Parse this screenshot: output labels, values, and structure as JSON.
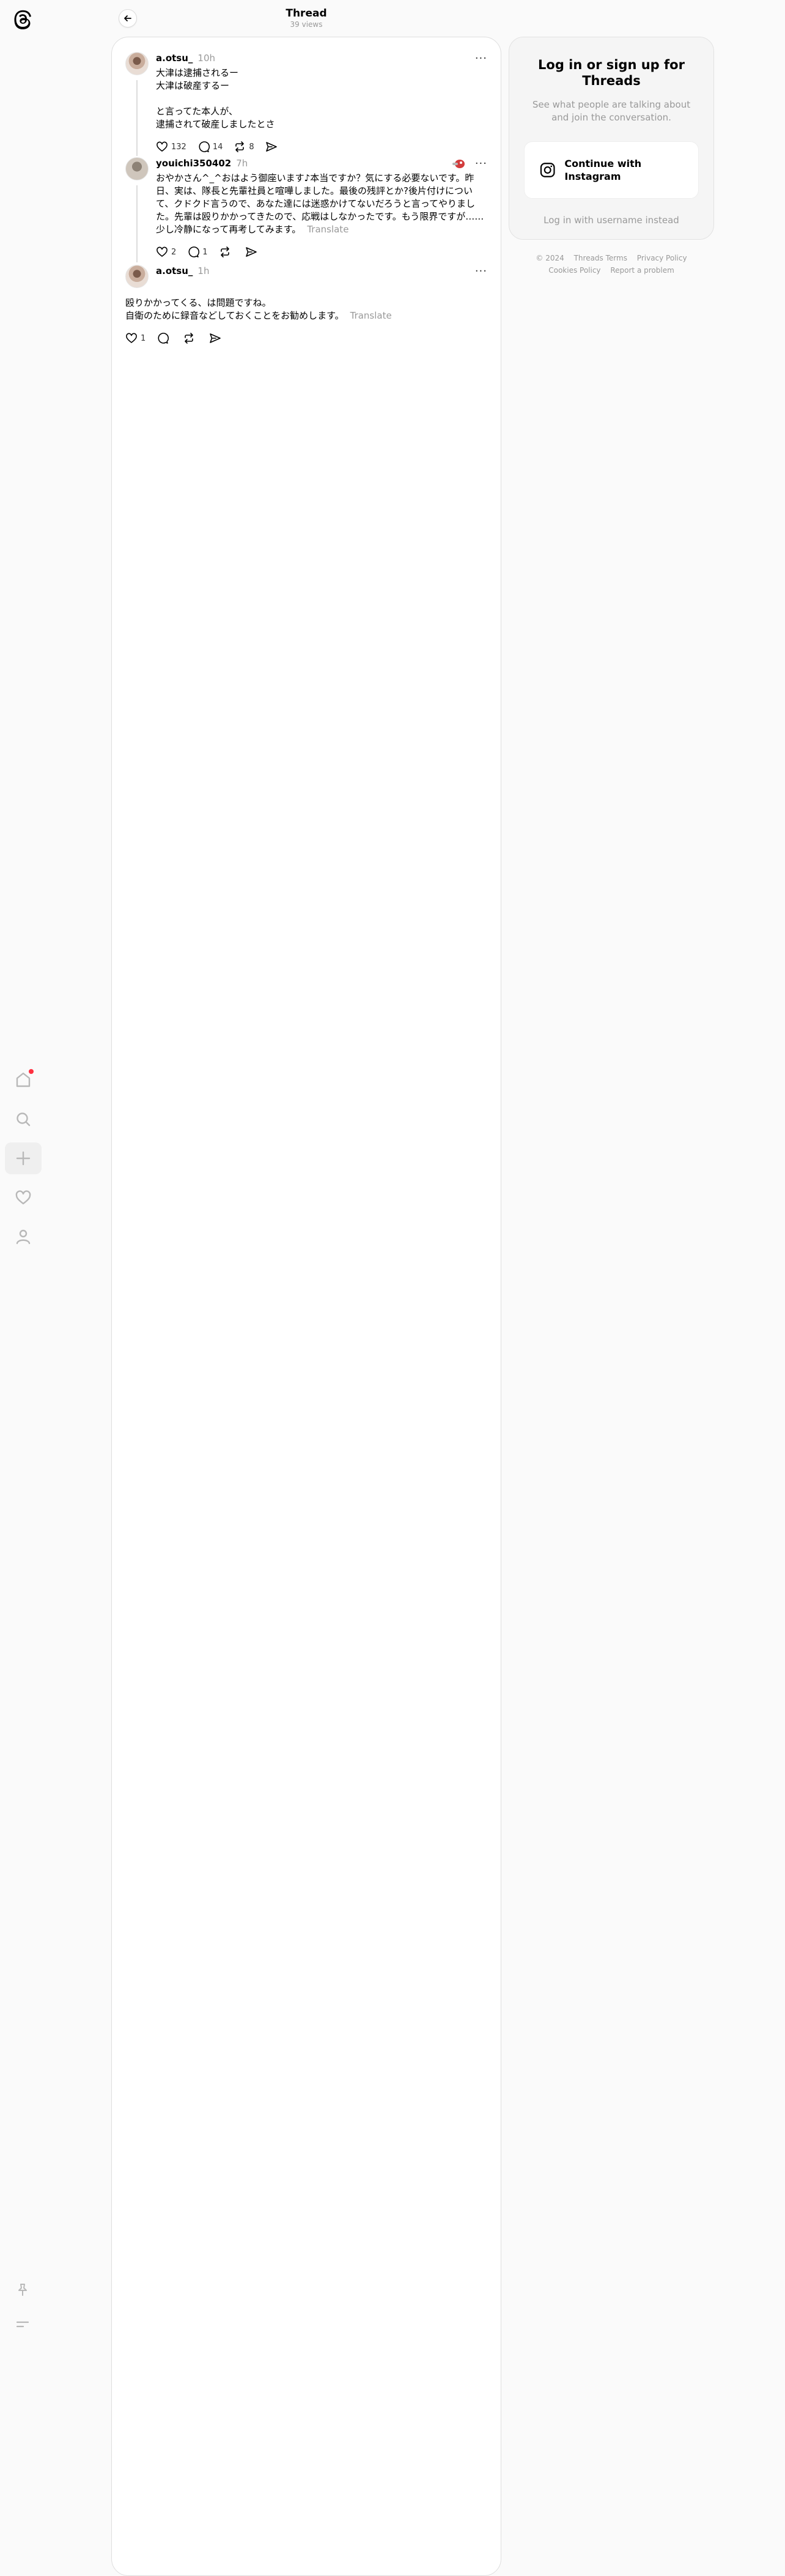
{
  "header": {
    "title": "Thread",
    "subtitle": "39 views"
  },
  "login": {
    "title": "Log in or sign up for Threads",
    "subtitle": "See what people are talking about and join the conversation.",
    "instagram_button": "Continue with Instagram",
    "alt_login": "Log in with username instead"
  },
  "footer": {
    "copyright": "© 2024",
    "terms": "Threads Terms",
    "privacy": "Privacy Policy",
    "cookies": "Cookies Policy",
    "report": "Report a problem"
  },
  "posts": [
    {
      "user": "a.otsu_",
      "time": "10h",
      "lines": [
        "大津は逮捕されるー",
        "大津は破産するー"
      ],
      "lines2": [
        "と言ってた本人が、",
        "逮捕されて破産しましたとさ"
      ],
      "likes": "132",
      "replies": "14",
      "reposts": "8"
    },
    {
      "user": "youichi350402",
      "time": "7h",
      "text": "おやかさん^_^おはよう御座います♪本当ですか？気にする必要ないです。昨日、実は、隊長と先輩社員と喧嘩しました。最後の残評とか?後片付けについて、クドクド言うので、あなた達には迷惑かけてないだろうと言ってやりました。先輩は殴りかかってきたので、応戦はしなかったです。もう限界ですが……少し冷静になって再考してみます。",
      "translate": "Translate",
      "likes": "2",
      "replies": "1"
    },
    {
      "user": "a.otsu_",
      "time": "1h",
      "lines": [
        "殴りかかってくる、は問題ですね。",
        "自衛のために録音などしておくことをお勧めします。"
      ],
      "translate": "Translate",
      "likes": "1"
    }
  ],
  "colors": {
    "notification_dot": "#ff3040",
    "muted_text": "#999999",
    "card_bg": "#ffffff",
    "page_bg": "#fafafa"
  }
}
